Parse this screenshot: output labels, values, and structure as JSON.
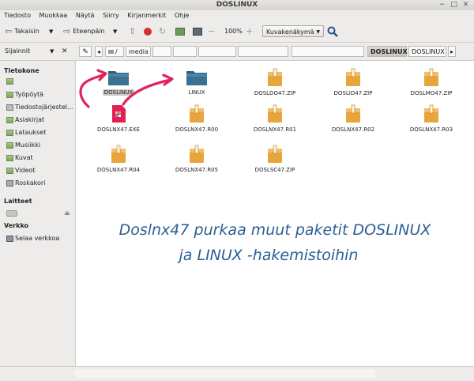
{
  "window": {
    "title": "DOSLINUX"
  },
  "menu": [
    "Tiedosto",
    "Muokkaa",
    "Näytä",
    "Siirry",
    "Kirjanmerkit",
    "Ohje"
  ],
  "toolbar": {
    "back_label": "Takaisin",
    "forward_label": "Eteenpäin",
    "zoom": "100%",
    "view_mode": "Kuvakenäkymä"
  },
  "location": {
    "side_label": "Sijainnit",
    "crumbs": [
      "/",
      "media",
      "DOSLINUX",
      "DOSLINUX"
    ]
  },
  "sidebar": {
    "computer_header": "Tietokone",
    "computer_items": [
      "Työpöytä",
      "Tiedostojärjestel...",
      "Asiakirjat",
      "Lataukset",
      "Musiikki",
      "Kuvat",
      "Videot",
      "Roskakori"
    ],
    "devices_header": "Laitteet",
    "network_header": "Verkko",
    "network_items": [
      "Selaa verkkoa"
    ]
  },
  "files": [
    {
      "name": "DOSLINUX",
      "type": "folder",
      "selected": true
    },
    {
      "name": "LINUX",
      "type": "folder"
    },
    {
      "name": "DOSLDO47.ZIP",
      "type": "zip"
    },
    {
      "name": "DOSLID47.ZIP",
      "type": "zip"
    },
    {
      "name": "DOSLMO47.ZIP",
      "type": "zip"
    },
    {
      "name": "DOSLNX47.EXE",
      "type": "exe"
    },
    {
      "name": "DOSLNX47.R00",
      "type": "zip"
    },
    {
      "name": "DOSLNX47.R01",
      "type": "zip"
    },
    {
      "name": "DOSLNX47.R02",
      "type": "zip"
    },
    {
      "name": "DOSLNX47.R03",
      "type": "zip"
    },
    {
      "name": "DOSLNX47.R04",
      "type": "zip"
    },
    {
      "name": "DOSLNX47.R05",
      "type": "zip"
    },
    {
      "name": "DOSLSC47.ZIP",
      "type": "zip"
    }
  ],
  "overlay": {
    "line1": "Doslnx47 purkaa muut paketit DOSLINUX",
    "line2": "ja LINUX -hakemistoihin"
  },
  "colors": {
    "overlay_text": "#2b5f93",
    "arrow": "#e0245e",
    "folder": "#3a6f8f",
    "zip": "#e6a53a"
  }
}
